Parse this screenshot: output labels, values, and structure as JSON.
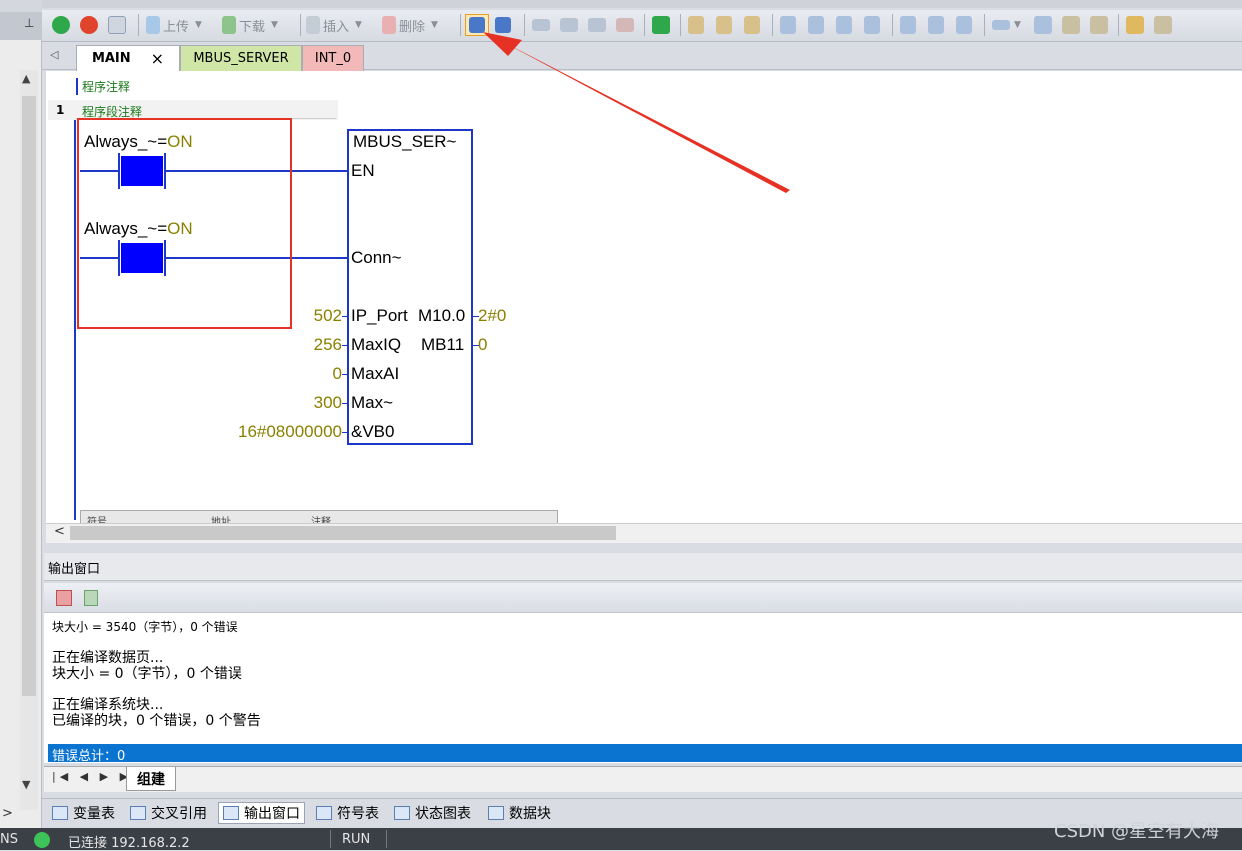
{
  "toolbar": {
    "upload_label": "上传",
    "download_label": "下载",
    "insert_label": "插入",
    "delete_label": "删除"
  },
  "tabs": [
    {
      "label": "MAIN",
      "close": "×"
    },
    {
      "label": "MBUS_SERVER"
    },
    {
      "label": "INT_0"
    }
  ],
  "editor": {
    "program_comment": "程序注释",
    "network_number": "1",
    "segment_comment": "程序段注释",
    "contacts": [
      {
        "symbol": "Always_~",
        "eq": "=",
        "state": "ON"
      },
      {
        "symbol": "Always_~",
        "eq": "=",
        "state": "ON"
      }
    ],
    "block": {
      "title": "MBUS_SER~",
      "inputs": [
        {
          "pin": "EN",
          "value": ""
        },
        {
          "pin": "Conn~",
          "value": ""
        },
        {
          "pin": "IP_Port",
          "value": "502"
        },
        {
          "pin": "MaxIQ",
          "value": "256"
        },
        {
          "pin": "MaxAI",
          "value": "0"
        },
        {
          "pin": "Max~",
          "value": "300"
        },
        {
          "pin": "&VB0",
          "value": "16#08000000"
        }
      ],
      "outputs": [
        {
          "pin": "M10.0",
          "value": "2#0"
        },
        {
          "pin": "MB11",
          "value": "0"
        }
      ]
    },
    "symbol_table_headers": [
      "符号",
      "地址",
      "注释"
    ]
  },
  "output": {
    "title": "输出窗口",
    "lines": [
      "块大小 = 3540（字节），0 个错误",
      "",
      "正在编译数据页...",
      "块大小 = 0（字节），0 个错误",
      "",
      "正在编译系统块...",
      "已编译的块，0 个错误，0 个警告"
    ],
    "selected_line": "错误总计：0",
    "tab": "组建"
  },
  "bottom_tabs": [
    "变量表",
    "交叉引用",
    "输出窗口",
    "符号表",
    "状态图表",
    "数据块"
  ],
  "status": {
    "mode": "NS",
    "connection": "已连接 192.168.2.2",
    "run": "RUN"
  },
  "watermark": "CSDN @星空有大海",
  "colors": {
    "annotation_red": "#e53224",
    "rung_blue": "#1d37c9",
    "contact_fill": "#0000ff",
    "selection_blue": "#0b73d0"
  }
}
